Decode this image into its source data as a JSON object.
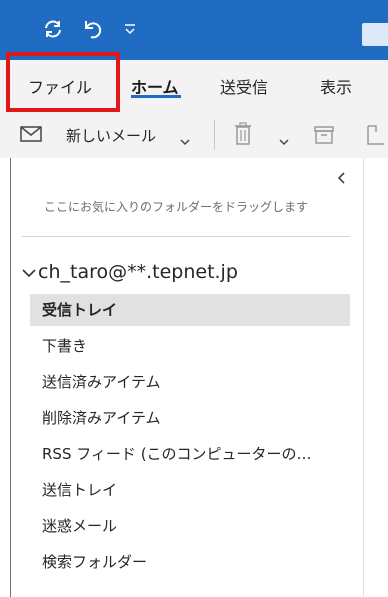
{
  "quick_access": {
    "icons": [
      "sync-icon",
      "undo-icon",
      "customize-dropdown-icon"
    ]
  },
  "tabs": [
    {
      "label": "ファイル"
    },
    {
      "label": "ホーム",
      "active": true
    },
    {
      "label": "送受信"
    },
    {
      "label": "表示"
    }
  ],
  "toolbar": {
    "new_mail_label": "新しいメール",
    "icons": [
      "envelope-icon",
      "chevron-down-icon",
      "delete-icon",
      "archive-icon",
      "move-icon"
    ]
  },
  "folder_pane": {
    "favorites_hint": "ここにお気に入りのフォルダーをドラッグします",
    "account": "ch_taro@**.tepnet.jp",
    "folders": [
      {
        "label": "受信トレイ",
        "selected": true
      },
      {
        "label": "下書き"
      },
      {
        "label": "送信済みアイテム"
      },
      {
        "label": "削除済みアイテム"
      },
      {
        "label": "RSS フィード (このコンピューターの…"
      },
      {
        "label": "送信トレイ"
      },
      {
        "label": "迷惑メール"
      },
      {
        "label": "検索フォルダー"
      }
    ]
  },
  "colors": {
    "title_bar": "#1f6cc2",
    "ribbon_bg": "#f3f3f3",
    "highlight_box": "#e0181b",
    "selected_folder_bg": "#e1e1e1"
  }
}
